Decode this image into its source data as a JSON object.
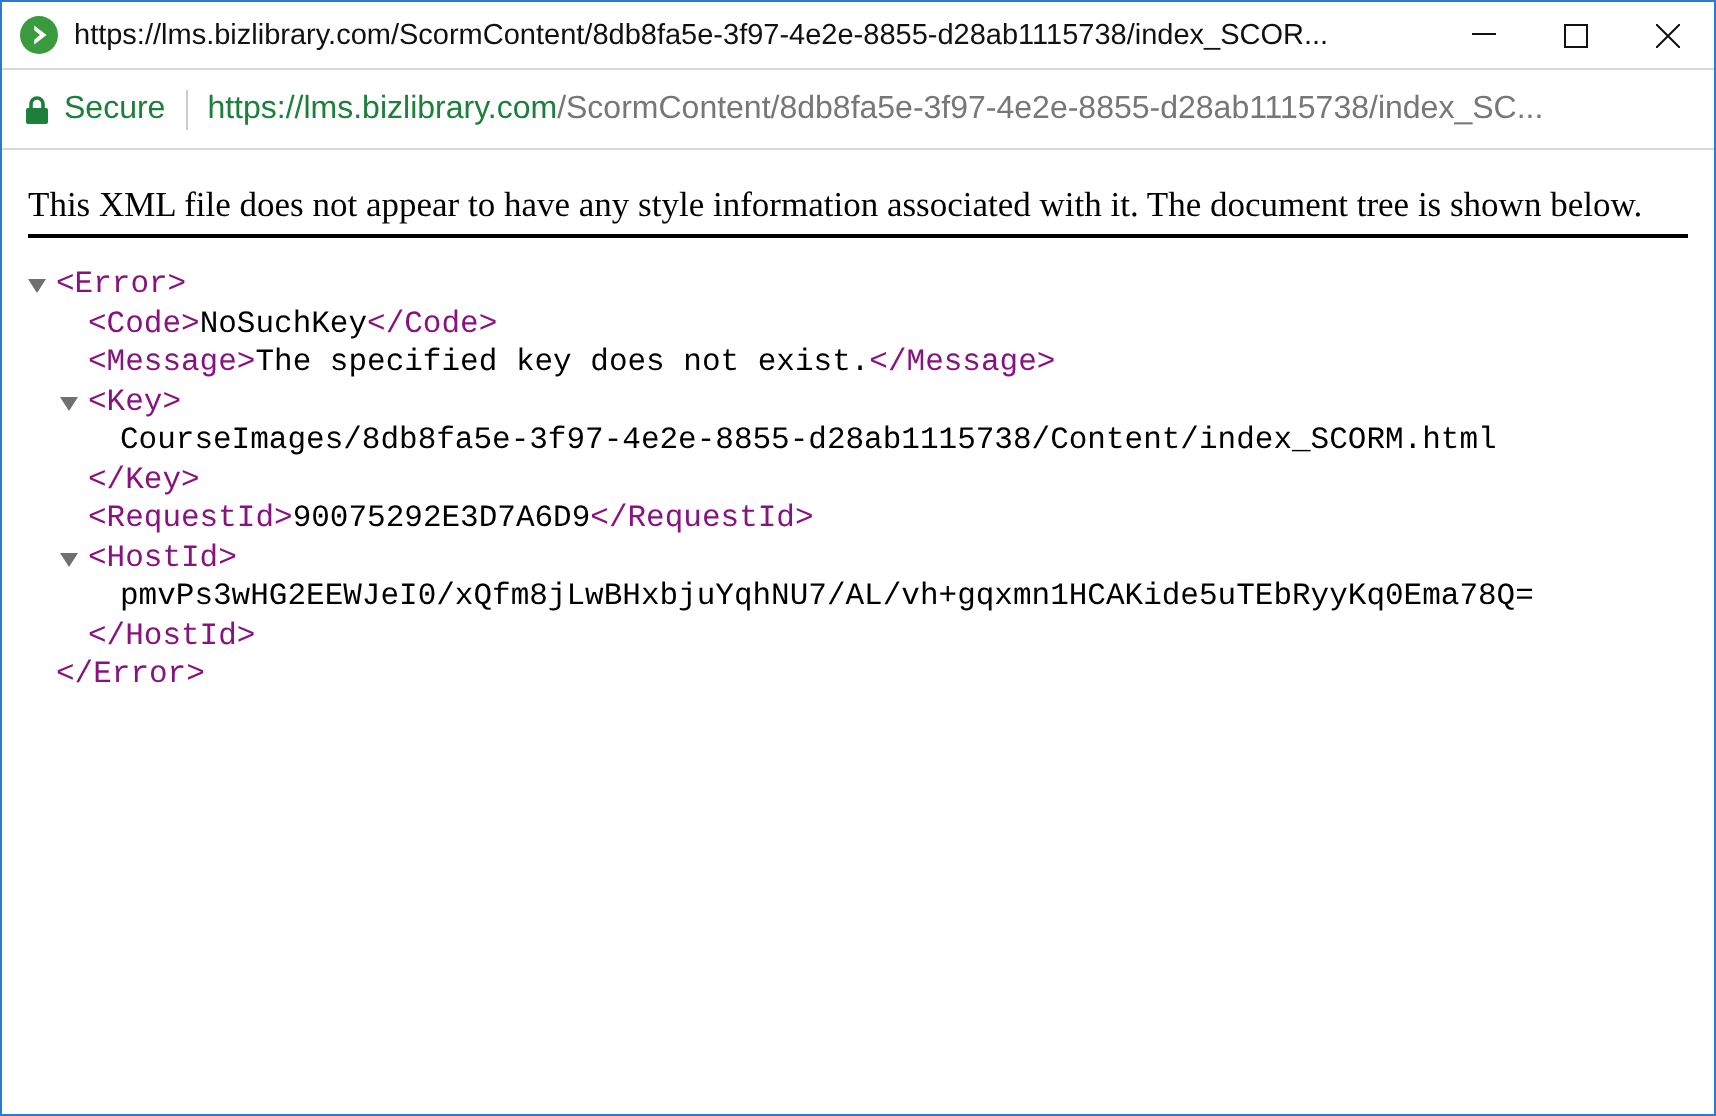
{
  "window": {
    "title": "https://lms.bizlibrary.com/ScormContent/8db8fa5e-3f97-4e2e-8855-d28ab1115738/index_SCOR..."
  },
  "address_bar": {
    "secure_label": "Secure",
    "url_host": "https://lms.bizlibrary.com",
    "url_path": "/ScormContent/8db8fa5e-3f97-4e2e-8855-d28ab1115738/index_SC..."
  },
  "notice": "This XML file does not appear to have any style information associated with it. The document tree is shown below.",
  "tree": [
    {
      "kind": "block",
      "open": "<Error>",
      "close": "</Error>",
      "expanded": true,
      "children": [
        {
          "kind": "inline",
          "open": "<Code>",
          "text": "NoSuchKey",
          "close": "</Code>"
        },
        {
          "kind": "inline",
          "open": "<Message>",
          "text": "The specified key does not exist.",
          "close": "</Message>"
        },
        {
          "kind": "block",
          "open": "<Key>",
          "close": "</Key>",
          "expanded": true,
          "children": [
            {
              "kind": "text",
              "text": "CourseImages/8db8fa5e-3f97-4e2e-8855-d28ab1115738/Content/index_SCORM.html"
            }
          ]
        },
        {
          "kind": "inline",
          "open": "<RequestId>",
          "text": "90075292E3D7A6D9",
          "close": "</RequestId>"
        },
        {
          "kind": "block",
          "open": "<HostId>",
          "close": "</HostId>",
          "expanded": true,
          "children": [
            {
              "kind": "text",
              "text": "pmvPs3wHG2EEWJeI0/xQfm8jLwBHxbjuYqhNU7/AL/vh+gqxmn1HCAKide5uTEbRyyKq0Ema78Q="
            }
          ]
        }
      ]
    }
  ]
}
